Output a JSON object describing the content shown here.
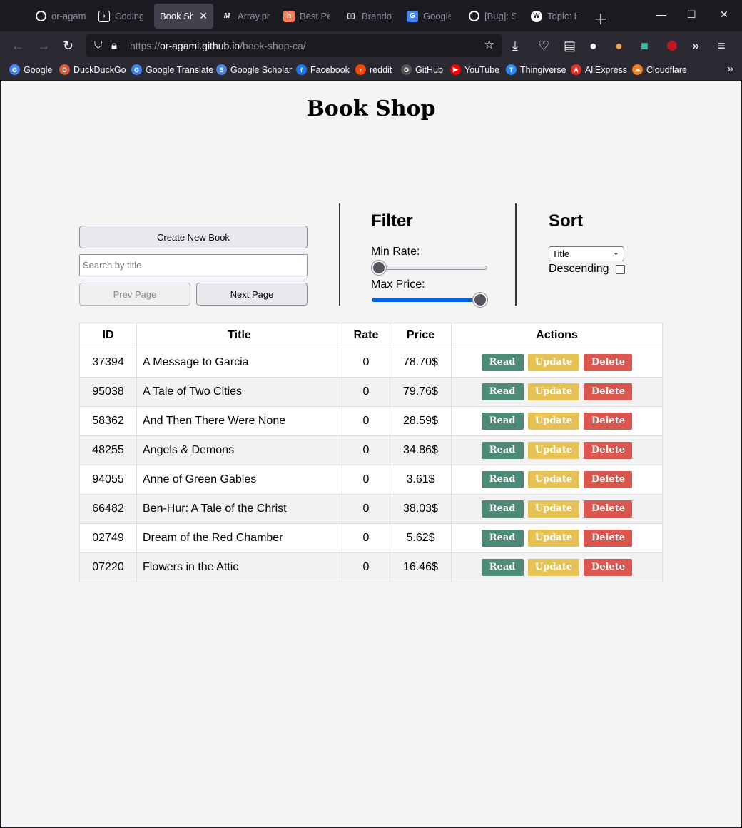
{
  "browser": {
    "tabs": [
      {
        "label": "or-agam",
        "icon": "github-icon"
      },
      {
        "label": "Coding",
        "icon": "code-icon"
      },
      {
        "label": "Book Sho",
        "icon": "",
        "active": true
      },
      {
        "label": "Array.pr",
        "icon": "medium-icon"
      },
      {
        "label": "Best Per",
        "icon": "hubspot-icon"
      },
      {
        "label": "Brandon",
        "icon": "dev-icon"
      },
      {
        "label": "Google T",
        "icon": "translate-icon"
      },
      {
        "label": "[Bug]: S",
        "icon": "github-icon"
      },
      {
        "label": "Topic: H",
        "icon": "wordpress-icon"
      }
    ],
    "url_prefix": "https://",
    "url_host": "or-agami.github.io",
    "url_path": "/book-shop-ca/",
    "bookmarks": [
      {
        "label": "Google",
        "color": "#4285f4",
        "glyph": "G"
      },
      {
        "label": "DuckDuckGo",
        "color": "#de5833",
        "glyph": "D"
      },
      {
        "label": "Google Translate",
        "color": "#4285f4",
        "glyph": "G"
      },
      {
        "label": "Google Scholar",
        "color": "#4a86e8",
        "glyph": "S"
      },
      {
        "label": "Facebook",
        "color": "#1877f2",
        "glyph": "f"
      },
      {
        "label": "reddit",
        "color": "#ff4500",
        "glyph": "r"
      },
      {
        "label": "GitHub",
        "color": "#555555",
        "glyph": "O"
      },
      {
        "label": "YouTube",
        "color": "#ff0000",
        "glyph": "▶"
      },
      {
        "label": "Thingiverse",
        "color": "#248bfb",
        "glyph": "T"
      },
      {
        "label": "AliExpress",
        "color": "#e43225",
        "glyph": "A"
      },
      {
        "label": "Cloudflare",
        "color": "#f38020",
        "glyph": "☁"
      }
    ]
  },
  "app": {
    "title": "Book Shop",
    "create_label": "Create New Book",
    "search_placeholder": "Search by title",
    "prev_label": "Prev Page",
    "next_label": "Next Page",
    "filter": {
      "heading": "Filter",
      "min_rate_label": "Min Rate:",
      "min_rate_level": 0,
      "max_price_label": "Max Price:",
      "max_price_level": 1
    },
    "sort": {
      "heading": "Sort",
      "selected": "Title",
      "descending_label": "Descending",
      "descending_checked": false
    },
    "table": {
      "headers": [
        "ID",
        "Title",
        "Rate",
        "Price",
        "Actions"
      ],
      "action_labels": {
        "read": "Read",
        "update": "Update",
        "delete": "Delete"
      },
      "rows": [
        {
          "id": "37394",
          "title": "A Message to Garcia",
          "rate": "0",
          "price": "78.70$"
        },
        {
          "id": "95038",
          "title": "A Tale of Two Cities",
          "rate": "0",
          "price": "79.76$"
        },
        {
          "id": "58362",
          "title": "And Then There Were None",
          "rate": "0",
          "price": "28.59$"
        },
        {
          "id": "48255",
          "title": "Angels & Demons",
          "rate": "0",
          "price": "34.86$"
        },
        {
          "id": "94055",
          "title": "Anne of Green Gables",
          "rate": "0",
          "price": "3.61$"
        },
        {
          "id": "66482",
          "title": "Ben-Hur: A Tale of the Christ",
          "rate": "0",
          "price": "38.03$"
        },
        {
          "id": "02749",
          "title": "Dream of the Red Chamber",
          "rate": "0",
          "price": "5.62$"
        },
        {
          "id": "07220",
          "title": "Flowers in the Attic",
          "rate": "0",
          "price": "16.46$"
        }
      ]
    }
  }
}
